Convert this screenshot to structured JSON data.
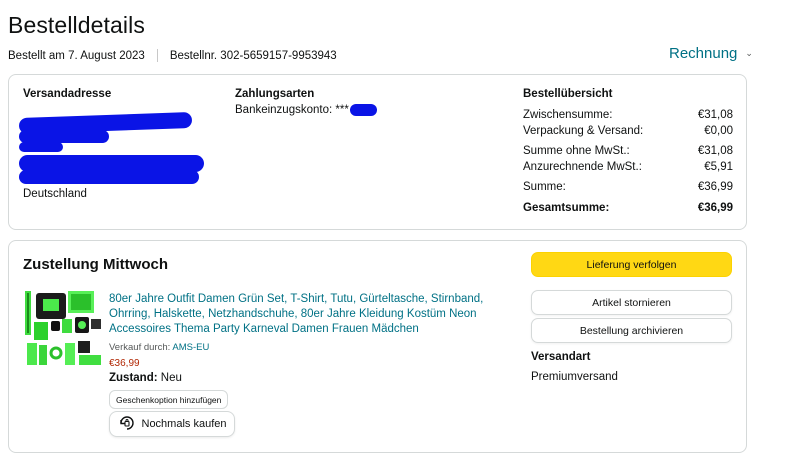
{
  "header": {
    "title": "Bestelldetails",
    "ordered_on": "Bestellt am 7. August 2023",
    "order_number": "Bestellnr. 302-5659157-9953943",
    "invoice_label": "Rechnung"
  },
  "shipping_address": {
    "heading": "Versandadresse",
    "country": "Deutschland"
  },
  "payment": {
    "heading": "Zahlungsarten",
    "method": "Bankeinzugskonto: ***"
  },
  "summary": {
    "heading": "Bestellübersicht",
    "rows": [
      {
        "label": "Zwischensumme:",
        "value": "€31,08"
      },
      {
        "label": "Verpackung & Versand:",
        "value": "€0,00"
      },
      {
        "label": "Summe ohne MwSt.:",
        "value": "€31,08"
      },
      {
        "label": "Anzurechnende MwSt.:",
        "value": "€5,91"
      },
      {
        "label": "Summe:",
        "value": "€36,99"
      },
      {
        "label": "Gesamtsumme:",
        "value": "€36,99"
      }
    ]
  },
  "delivery": {
    "heading": "Zustellung Mittwoch",
    "product": {
      "title": "80er Jahre Outfit Damen Grün Set, T-Shirt, Tutu, Gürteltasche, Stirnband, Ohrring, Halskette, Netzhandschuhe, 80er Jahre Kleidung Kostüm Neon Accessoires Thema Party Karneval Damen Frauen Mädchen",
      "seller_prefix": "Verkauf durch:",
      "seller_name": "AMS-EU",
      "price": "€36,99",
      "condition_label": "Zustand:",
      "condition_value": "Neu",
      "gift_label": "Geschenkoption hinzufügen",
      "rebuy_label": "Nochmals kaufen"
    },
    "actions": {
      "track": "Lieferung verfolgen",
      "cancel": "Artikel stornieren",
      "archive": "Bestellung archivieren"
    },
    "shipping_method_heading": "Versandart",
    "shipping_method": "Premiumversand"
  },
  "colors": {
    "link": "#007185",
    "primary_button": "#ffd814",
    "price": "#b12704",
    "redaction": "#0a14e6"
  }
}
